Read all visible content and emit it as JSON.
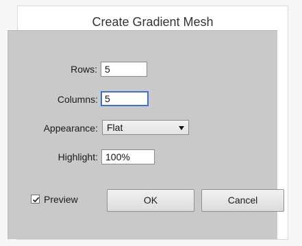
{
  "dialog": {
    "title": "Create Gradient Mesh",
    "rows": {
      "label": "Rows:",
      "value": "5"
    },
    "columns": {
      "label": "Columns:",
      "value": "5"
    },
    "appearance": {
      "label": "Appearance:",
      "selected": "Flat"
    },
    "highlight": {
      "label": "Highlight:",
      "value": "100%"
    },
    "preview": {
      "label": "Preview",
      "checked": true
    },
    "ok_label": "OK",
    "cancel_label": "Cancel"
  },
  "colors": {
    "panel_bg": "#c9c9c9",
    "focus_accent": "#3a72c8"
  }
}
